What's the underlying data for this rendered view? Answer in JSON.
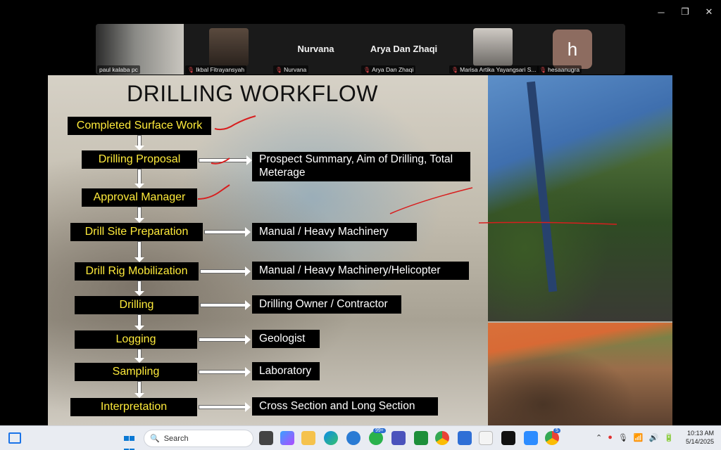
{
  "participants": [
    {
      "name": "paul kalaba pc",
      "muted": false
    },
    {
      "name": "Ikbal Fitrayansyah",
      "muted": true
    },
    {
      "name": "Nurvana",
      "display": "Nurvana",
      "muted": true
    },
    {
      "name": "Arya Dan Zhaqi",
      "display": "Arya Dan Zhaqi",
      "muted": true
    },
    {
      "name": "Marisa Artika Yayangsari S...",
      "muted": true
    },
    {
      "name": "hesaanugra",
      "avatar_letter": "h",
      "muted": true
    }
  ],
  "slide": {
    "title": "DRILLING WORKFLOW",
    "steps": [
      "Completed Surface Work",
      "Drilling Proposal",
      "Approval Manager",
      "Drill Site Preparation",
      "Drill Rig Mobilization",
      "Drilling",
      "Logging",
      "Sampling",
      "Interpretation"
    ],
    "details": [
      "Prospect Summary, Aim of Drilling, Total Meterage",
      "Manual / Heavy Machinery",
      "Manual / Heavy Machinery/Helicopter",
      "Drilling Owner / Contractor",
      "Geologist",
      "Laboratory",
      "Cross Section and Long Section"
    ]
  },
  "taskbar": {
    "search_placeholder": "Search",
    "teams_badge": "99+",
    "chrome_badge": "5",
    "time": "10:13 AM",
    "date": "5/14/2025"
  },
  "colors": {
    "step_text": "#ffeb3b",
    "box_bg": "#000000",
    "annotation": "#d81e1e"
  }
}
